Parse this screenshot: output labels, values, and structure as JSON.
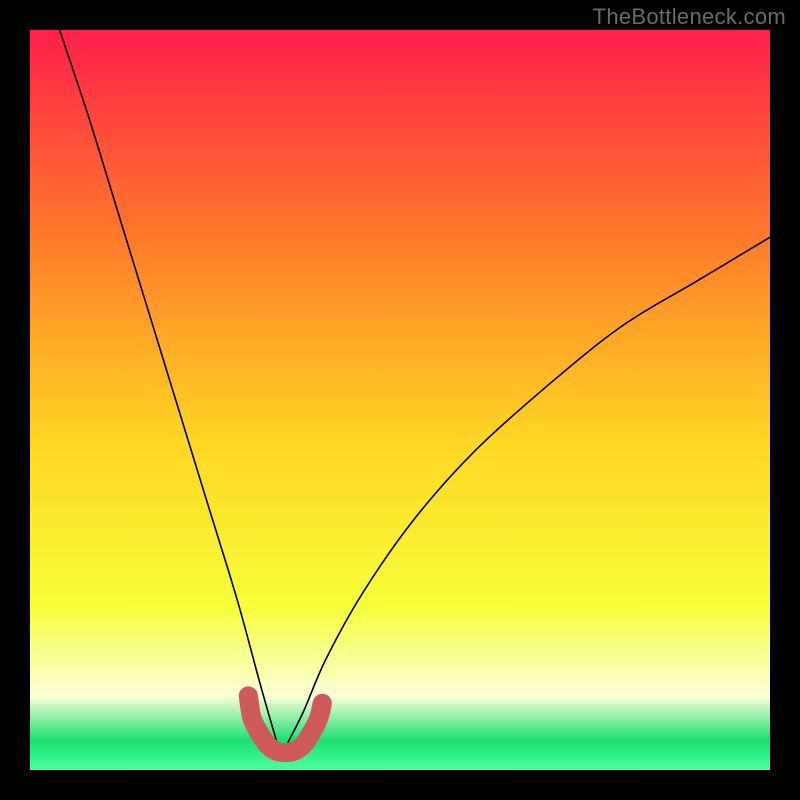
{
  "watermark": "TheBottleneck.com",
  "gradient": {
    "top": "#ff1f4b",
    "upper_mid": "#ff7a2a",
    "mid": "#ffd523",
    "lower_mid": "#f6ff3a",
    "pale": "#fbffd8",
    "green": "#18e072",
    "bottom": "#4dffa0"
  },
  "chart_data": {
    "type": "line",
    "title": "",
    "xlabel": "",
    "ylabel": "",
    "xlim": [
      0,
      100
    ],
    "ylim": [
      0,
      100
    ],
    "series": [
      {
        "name": "bottleneck-curve",
        "color": "#000000",
        "x_at_min": 34,
        "y_min": 2,
        "x": [
          4,
          8,
          12,
          16,
          20,
          24,
          28,
          31,
          33,
          34,
          35,
          37,
          40,
          45,
          52,
          60,
          70,
          80,
          90,
          100
        ],
        "values": [
          100,
          88,
          75,
          62,
          49,
          36,
          23,
          12,
          5,
          2,
          4,
          8,
          15,
          24,
          34,
          43,
          52,
          60,
          66,
          72
        ]
      },
      {
        "name": "highlight-band",
        "color": "#cf5a5a",
        "x": [
          29.5,
          30,
          31,
          32,
          33,
          34,
          35,
          36,
          37,
          38,
          39,
          39.5
        ],
        "values": [
          10,
          7,
          5,
          3.5,
          2.7,
          2.4,
          2.4,
          2.7,
          3.5,
          5,
          7,
          9
        ]
      }
    ],
    "dots": [
      {
        "x": 29.5,
        "y": 10,
        "r": 1.0,
        "color": "#cf5a5a"
      }
    ]
  }
}
